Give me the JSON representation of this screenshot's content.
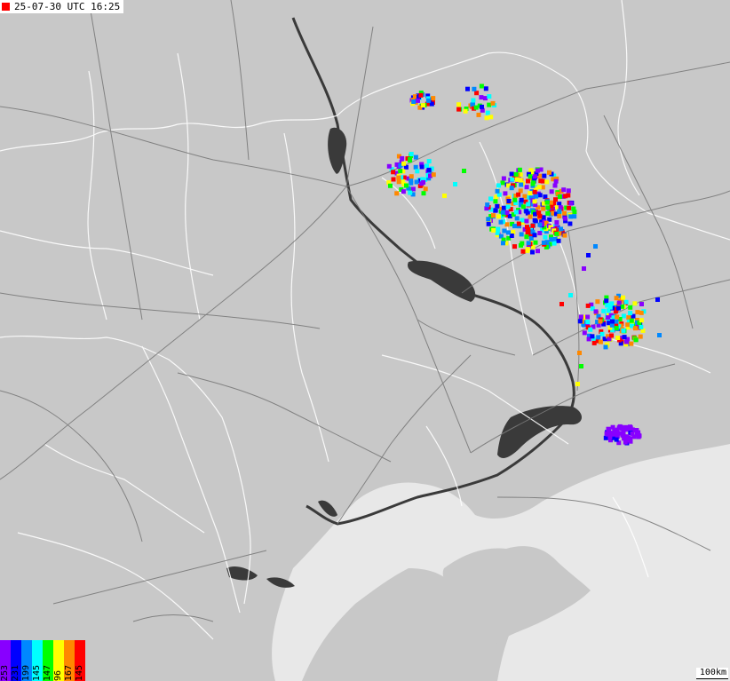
{
  "timestamp": "25-07-30 UTC 16:25",
  "timestamp_marker_color": "#ff0000",
  "scale_label": "100km",
  "legend": [
    {
      "label": "253",
      "color": "#8800ff"
    },
    {
      "label": "231",
      "color": "#0000ff"
    },
    {
      "label": "199",
      "color": "#0088ff"
    },
    {
      "label": "145",
      "color": "#00ffff"
    },
    {
      "label": "147",
      "color": "#00ff00"
    },
    {
      "label": "96",
      "color": "#ffff00"
    },
    {
      "label": "167",
      "color": "#ff8800"
    },
    {
      "label": "145",
      "color": "#ff0000"
    }
  ],
  "colors": {
    "land": "#c8c8c8",
    "sea": "#e8e8e8",
    "water": "#3a3a3a",
    "roads": "#7a7a7a",
    "borders": "#ffffff"
  },
  "strike_clusters": [
    {
      "name": "north-west",
      "count": 30
    },
    {
      "name": "north",
      "count": 30
    },
    {
      "name": "west-central",
      "count": 70
    },
    {
      "name": "central",
      "count": 320
    },
    {
      "name": "east",
      "count": 160
    },
    {
      "name": "south-east",
      "count": 60
    }
  ]
}
